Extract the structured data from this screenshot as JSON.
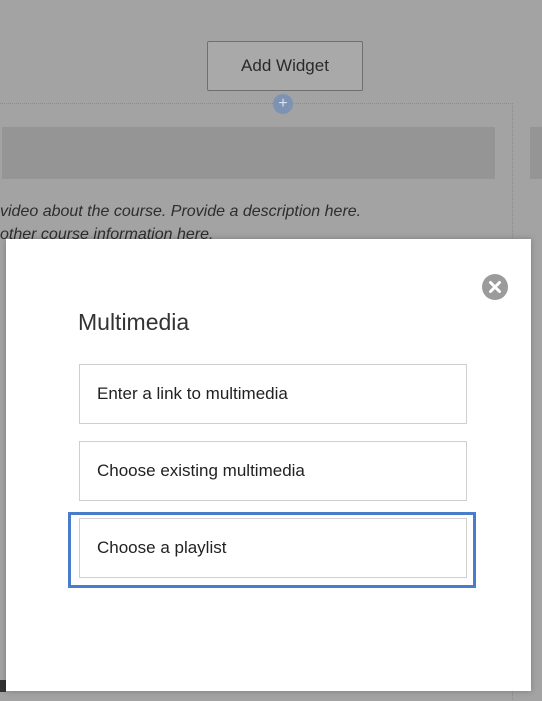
{
  "toolbar": {
    "add_widget_label": "Add Widget",
    "add_icon_glyph": "+"
  },
  "background": {
    "description_line_1": "video about the course. Provide a description here.",
    "description_line_2": "other course information here."
  },
  "modal": {
    "title": "Multimedia",
    "close_icon": "close-icon",
    "options": [
      {
        "label": "Enter a link to multimedia"
      },
      {
        "label": "Choose existing multimedia"
      },
      {
        "label": "Choose a playlist",
        "focused": true
      }
    ]
  },
  "colors": {
    "overlay": "#a3a3a3",
    "focus": "#4a7dc9",
    "close_icon": "#9b9b9b"
  }
}
